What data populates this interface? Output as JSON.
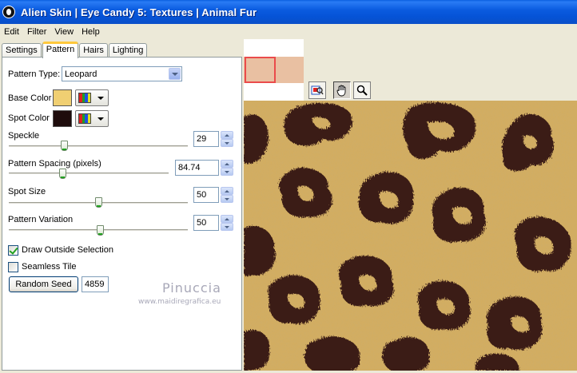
{
  "window": {
    "title": "Alien Skin | Eye Candy 5: Textures | Animal Fur"
  },
  "menu": [
    "Edit",
    "Filter",
    "View",
    "Help"
  ],
  "tabs": [
    "Settings",
    "Pattern",
    "Hairs",
    "Lighting"
  ],
  "active_tab": "Pattern",
  "pattern": {
    "pattern_type_label": "Pattern Type:",
    "pattern_type_value": "Leopard",
    "base_color_label": "Base Color",
    "base_color": "#f0cf72",
    "spot_color_label": "Spot Color",
    "spot_color": "#1e0c0c",
    "speckle_label": "Speckle",
    "speckle_value": "29",
    "spacing_label": "Pattern Spacing (pixels)",
    "spacing_value": "84.74",
    "spot_size_label": "Spot Size",
    "spot_size_value": "50",
    "variation_label": "Pattern Variation",
    "variation_value": "50",
    "draw_outside_label": "Draw Outside Selection",
    "draw_outside_checked": true,
    "seamless_label": "Seamless Tile",
    "seamless_checked": false,
    "random_seed_label": "Random Seed",
    "random_seed_value": "4859"
  },
  "watermark": {
    "name": "Pinuccia",
    "url": "www.maidiregrafica.eu"
  },
  "tools": [
    "navigator-icon",
    "hand-icon",
    "zoom-icon"
  ],
  "colors": {
    "fur_base": "#d4ad5e",
    "fur_spot": "#3a1f16",
    "fur_inner": "#b8914c"
  }
}
